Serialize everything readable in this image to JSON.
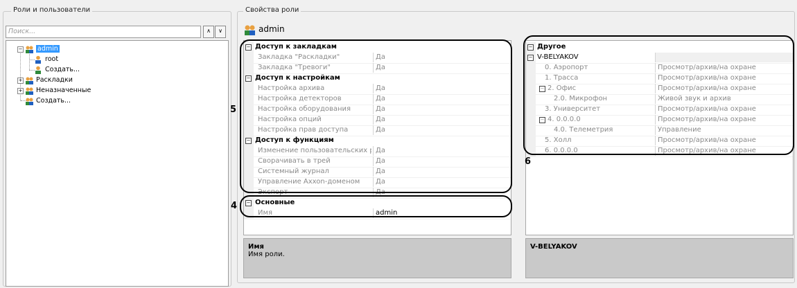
{
  "roles_panel": {
    "title": "Роли и пользователи",
    "search": {
      "placeholder": "Поиск..."
    },
    "tree": {
      "admin": "admin",
      "root": "root",
      "create_user": "Создать...",
      "layouts": "Раскладки",
      "unassigned": "Неназначенные",
      "create_role": "Создать..."
    }
  },
  "role_props": {
    "title": "Свойства роли",
    "role_name": "admin",
    "left_grid": [
      {
        "type": "cat",
        "label": "Доступ к закладкам"
      },
      {
        "type": "prop",
        "label": "Закладка \"Раскладки\"",
        "value": "Да"
      },
      {
        "type": "prop",
        "label": "Закладка \"Тревоги\"",
        "value": "Да"
      },
      {
        "type": "cat",
        "label": "Доступ к настройкам"
      },
      {
        "type": "prop",
        "label": "Настройка архива",
        "value": "Да"
      },
      {
        "type": "prop",
        "label": "Настройка детекторов",
        "value": "Да"
      },
      {
        "type": "prop",
        "label": "Настройка оборудования",
        "value": "Да"
      },
      {
        "type": "prop",
        "label": "Настройка опций",
        "value": "Да"
      },
      {
        "type": "prop",
        "label": "Настройка прав доступа",
        "value": "Да"
      },
      {
        "type": "cat",
        "label": "Доступ к функциям"
      },
      {
        "type": "prop",
        "label": "Изменение пользовательских раскл",
        "value": "Да"
      },
      {
        "type": "prop",
        "label": "Сворачивать в трей",
        "value": "Да"
      },
      {
        "type": "prop",
        "label": "Системный журнал",
        "value": "Да"
      },
      {
        "type": "prop",
        "label": "Управление Axxon-доменом",
        "value": "Да"
      },
      {
        "type": "prop",
        "label": "Экспорт",
        "value": "Да"
      },
      {
        "type": "cat",
        "label": "Основные"
      },
      {
        "type": "prop",
        "label": "Имя",
        "value": "admin",
        "editable": true
      }
    ],
    "left_desc": {
      "title": "Имя",
      "text": "Имя роли."
    },
    "right_grid": [
      {
        "type": "cat",
        "label": "Другое"
      },
      {
        "type": "node",
        "label": "V-BELYAKOV",
        "value": ""
      },
      {
        "type": "prop",
        "label": "0. Аэропорт",
        "value": "Просмотр/архив/на охране"
      },
      {
        "type": "prop",
        "label": "1. Трасса",
        "value": "Просмотр/архив/на охране"
      },
      {
        "type": "sub",
        "label": "2. Офис",
        "value": "Просмотр/архив/на охране"
      },
      {
        "type": "prop2",
        "label": "2.0. Микрофон",
        "value": "Живой звук и архив"
      },
      {
        "type": "prop",
        "label": "3. Университет",
        "value": "Просмотр/архив/на охране"
      },
      {
        "type": "sub",
        "label": "4. 0.0.0.0",
        "value": "Просмотр/архив/на охране"
      },
      {
        "type": "prop2",
        "label": "4.0. Телеметрия",
        "value": "Управление"
      },
      {
        "type": "prop",
        "label": "5. Холл",
        "value": "Просмотр/архив/на охране"
      },
      {
        "type": "prop",
        "label": "6. 0.0.0.0",
        "value": "Просмотр/архив/на охране"
      }
    ],
    "right_desc": {
      "title": "V-BELYAKOV",
      "text": ""
    }
  },
  "callouts": {
    "c4": "4",
    "c5": "5",
    "c6": "6"
  },
  "colors": {
    "selection": "#3399ff",
    "panel": "#f0f0f0",
    "desc": "#c9c9c9"
  }
}
